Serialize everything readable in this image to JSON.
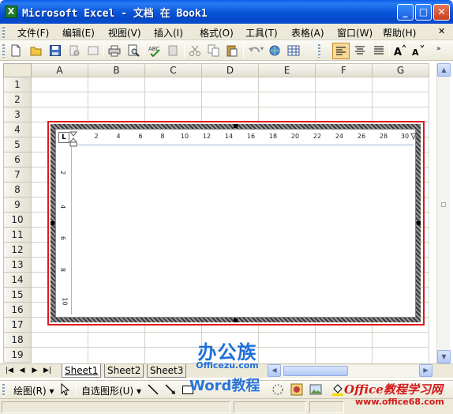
{
  "window": {
    "icon_letter": "X",
    "title": "Microsoft Excel - 文档 在 Book1",
    "minimize": "_",
    "maximize": "□",
    "close": "✕"
  },
  "menu": [
    {
      "label": "文件(F)"
    },
    {
      "label": "编辑(E)"
    },
    {
      "label": "视图(V)"
    },
    {
      "label": "插入(I)"
    },
    {
      "label": "格式(O)"
    },
    {
      "label": "工具(T)"
    },
    {
      "label": "表格(A)"
    },
    {
      "label": "窗口(W)"
    },
    {
      "label": "帮助(H)"
    }
  ],
  "menu_close": "✕",
  "toolbar_icons": [
    "new-icon",
    "open-icon",
    "save-icon",
    "permission-icon",
    "print-icon",
    "print-preview-icon",
    "spelling-icon",
    "research-icon",
    "cut-icon",
    "copy-icon",
    "paste-icon",
    "undo-icon",
    "hyperlink-icon",
    "table-icon",
    "align-left-icon",
    "align-center-icon",
    "justify-icon",
    "grow-font-icon",
    "shrink-font-icon"
  ],
  "columns": [
    "A",
    "B",
    "C",
    "D",
    "E",
    "F",
    "G"
  ],
  "rows": [
    "1",
    "2",
    "3",
    "4",
    "5",
    "6",
    "7",
    "8",
    "9",
    "10",
    "11",
    "12",
    "13",
    "14",
    "15",
    "16",
    "17",
    "18",
    "19"
  ],
  "word_object": {
    "ruler_corner": "L",
    "ruler_top": [
      "2",
      "4",
      "6",
      "8",
      "10",
      "12",
      "14",
      "16",
      "18",
      "20",
      "22",
      "24",
      "26",
      "28",
      "30"
    ],
    "ruler_left": [
      "2",
      "4",
      "6",
      "8",
      "10"
    ]
  },
  "sheet_tabs": [
    "Sheet1",
    "Sheet2",
    "Sheet3"
  ],
  "drawing_toolbar": {
    "draw_label": "绘图(R) ▾",
    "autoshapes_label": "自选图形(U) ▾"
  },
  "watermarks": {
    "brand_cn": "办公族",
    "brand_url": "Officezu.com",
    "word_tutorial": "Word教程",
    "office_site": "Office教程学习网",
    "office_url": "www.office68.com"
  },
  "colors": {
    "title_bar": "#0a56da",
    "selection_border": "#e0181c",
    "watermark_blue": "#1e6fd9",
    "watermark_red": "#d21a1a"
  }
}
